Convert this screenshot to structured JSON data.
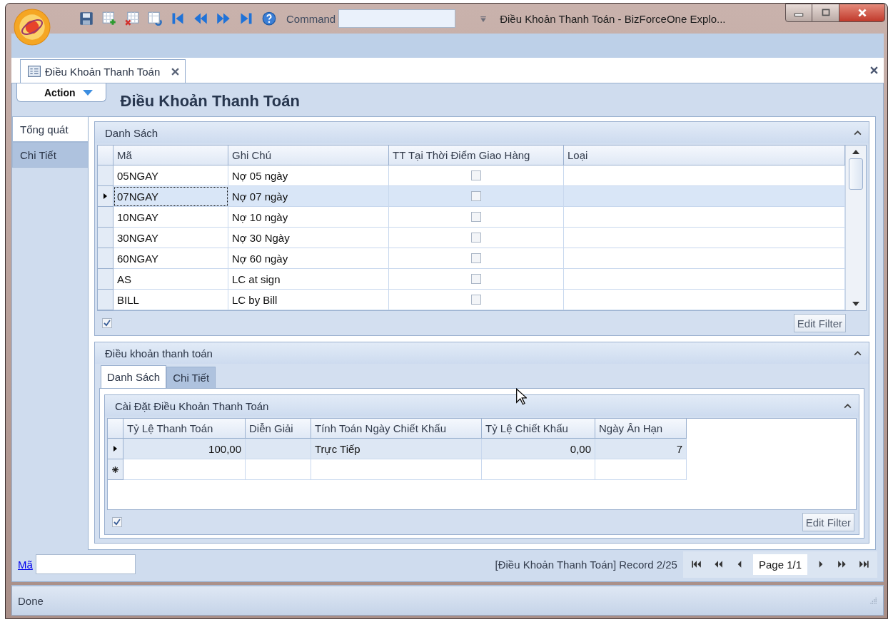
{
  "window": {
    "title": "Điều Khoản Thanh Toán - BizForceOne Explo...",
    "command_label": "Command"
  },
  "doc_tab": {
    "label": "Điều Khoản Thanh Toán"
  },
  "action": {
    "label": "Action"
  },
  "heading": "Điều Khoản Thanh Toán",
  "side_tabs": [
    {
      "label": "Tổng quát",
      "selected": true
    },
    {
      "label": "Chi Tiết",
      "selected": false
    }
  ],
  "list_group": {
    "title": "Danh Sách",
    "columns": [
      "Mã",
      "Ghi Chú",
      "TT Tại Thời Điểm Giao Hàng",
      "Loại"
    ],
    "rows": [
      {
        "ma": "05NGAY",
        "ghi_chu": "Nợ 05 ngày",
        "tt": false,
        "selected": false
      },
      {
        "ma": "07NGAY",
        "ghi_chu": "Nợ 07 ngày",
        "tt": false,
        "selected": true
      },
      {
        "ma": "10NGAY",
        "ghi_chu": "Nợ 10 ngày",
        "tt": false,
        "selected": false
      },
      {
        "ma": "30NGAY",
        "ghi_chu": "Nợ 30 Ngày",
        "tt": false,
        "selected": false
      },
      {
        "ma": "60NGAY",
        "ghi_chu": "Nợ 60 ngày",
        "tt": false,
        "selected": false
      },
      {
        "ma": "AS",
        "ghi_chu": "LC at sign",
        "tt": false,
        "selected": false
      },
      {
        "ma": "BILL",
        "ghi_chu": "LC by Bill",
        "tt": false,
        "selected": false
      }
    ],
    "footer_checked": true,
    "edit_filter": "Edit Filter"
  },
  "terms_group": {
    "title": "Điều khoản thanh toán",
    "tabs": [
      {
        "label": "Danh Sách",
        "selected": true
      },
      {
        "label": "Chi Tiết",
        "selected": false
      }
    ],
    "inner_title": "Cài Đặt Điều Khoản Thanh Toán",
    "columns": [
      "Tỷ Lệ Thanh Toán",
      "Diễn Giải",
      "Tính Toán Ngày Chiết Khấu",
      "Tỷ Lệ Chiết Khấu",
      "Ngày Ân Hạn"
    ],
    "rows": [
      {
        "kind": "data",
        "selected": true,
        "cells": [
          "100,00",
          "",
          "Trực Tiếp",
          "0,00",
          "7"
        ]
      },
      {
        "kind": "new",
        "selected": false,
        "cells": [
          "",
          "",
          "",
          "",
          ""
        ]
      }
    ],
    "footer_checked": true,
    "edit_filter": "Edit Filter"
  },
  "bottom": {
    "filter_label": "Mã",
    "record": "[Điều Khoản Thanh Toán] Record 2/25",
    "page": "Page 1/1"
  },
  "status_bar": "Done"
}
